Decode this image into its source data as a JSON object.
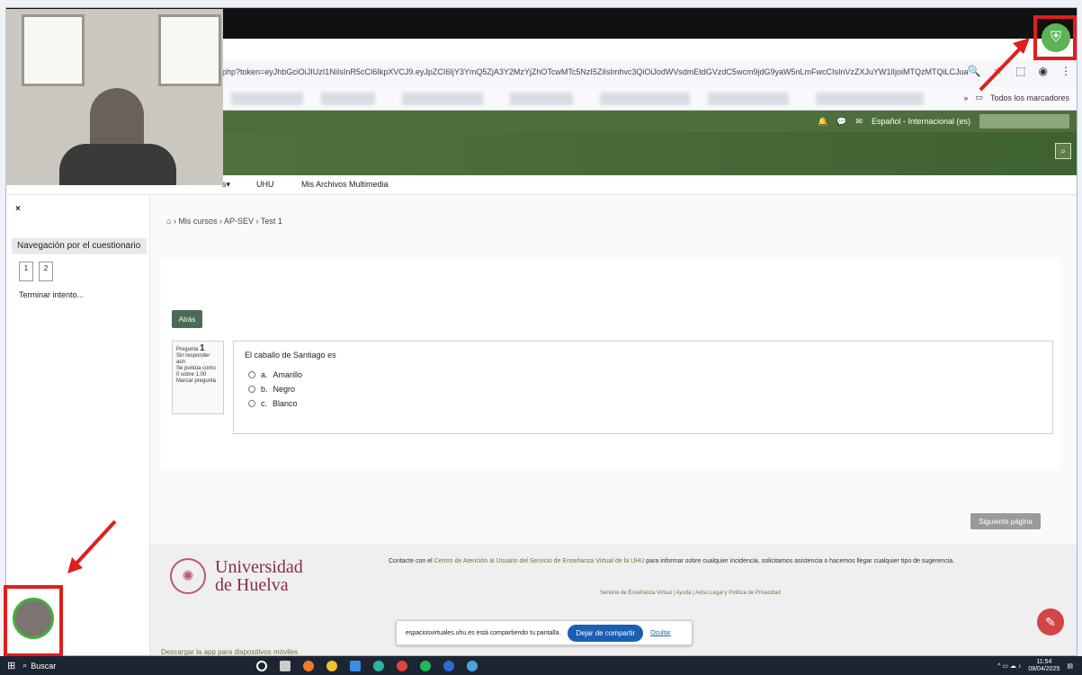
{
  "browser": {
    "url": "php?token=eyJhbGciOiJIUzI1NiIsInR5cCI6IkpXVCJ9.eyJpZCI6IjY3YmQ5ZjA3Y2MzYjZhOTcwMTc5NzI5ZiIsImhvc3QiOiJodWVsdmEtdGVzdC5wcm9jdG9yaW5nLmFwcCIsInVzZXJuYW1lIjoiMTQzMTQiLCJuaWNrbmFtZSI6...",
    "bookmarks_all": "Todos los marcadores",
    "overflow": "»"
  },
  "header": {
    "language": "Español - Internacional (es)"
  },
  "nav": {
    "items": [
      "s▾",
      "UHU",
      "Mis Archivos Multimedia"
    ]
  },
  "sidebar": {
    "close": "×",
    "nav_title": "Navegación por el cuestionario",
    "questions": [
      "1",
      "2"
    ],
    "finish": "Terminar intento..."
  },
  "breadcrumb": {
    "home_icon": "home-icon",
    "items": [
      "Mis cursos",
      "AP-SEV",
      "Test 1"
    ]
  },
  "quiz": {
    "back_button": "Atrás",
    "question_label": "Pregunta",
    "question_number": "1",
    "status": "Sin responder aún",
    "score": "Se puntúa como 0 sobre 1.00",
    "flag": "Marcar pregunta",
    "prompt": "El caballo de Santiago es",
    "options": [
      {
        "letter": "a.",
        "text": "Amarillo"
      },
      {
        "letter": "b.",
        "text": "Negro"
      },
      {
        "letter": "c.",
        "text": "Blanco"
      }
    ],
    "next_button": "Siguiente página"
  },
  "footer": {
    "logo_line1": "Universidad",
    "logo_line2": "de Huelva",
    "contact_pre": "Contacte con el",
    "contact_link": "Centro de Atención al Usuario del Servicio de Enseñanza Virtual de la UHU",
    "contact_post": "para informar sobre cualquier incidencia, solicitamos asistencia o hacemos llegar cualquier tipo de sugerencia.",
    "links": "Servicio de Enseñanza Virtual | Ayuda | Aviso Legal y Política de Privacidad",
    "download": "Descargar la app para dispositivos móviles"
  },
  "share_bar": {
    "message": "espaciosvirtuales.uhu.es está compartiendo tu pantalla.",
    "stop": "Dejar de compartir",
    "hide": "Ocultar"
  },
  "taskbar": {
    "search": "Buscar",
    "time": "11:54",
    "date": "08/04/2025"
  },
  "colors": {
    "moodle_green": "#4e6f3c",
    "highlight_red": "#e21d1d",
    "shield_green": "#5bb455"
  }
}
